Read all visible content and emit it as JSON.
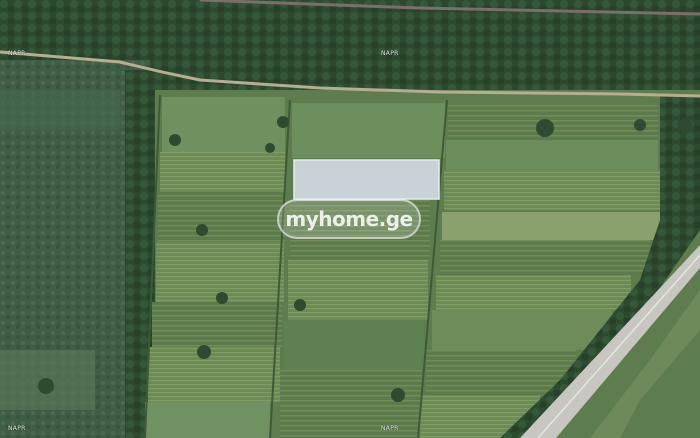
{
  "map": {
    "imagery": "satellite",
    "provider_labels": [
      "NAPR",
      "NAPR",
      "NAPR",
      "NAPR"
    ],
    "watermark": "myhome.ge",
    "highlighted_parcel": {
      "fill": "#c9d2d6",
      "outline": "#dfe8ee"
    },
    "colors": {
      "forest": "#2c4a30",
      "field_light": "#6f8f5c",
      "field_dark": "#4e6b45",
      "road": "#c8c6bd",
      "dirt_track": "#b9ad8f"
    }
  }
}
